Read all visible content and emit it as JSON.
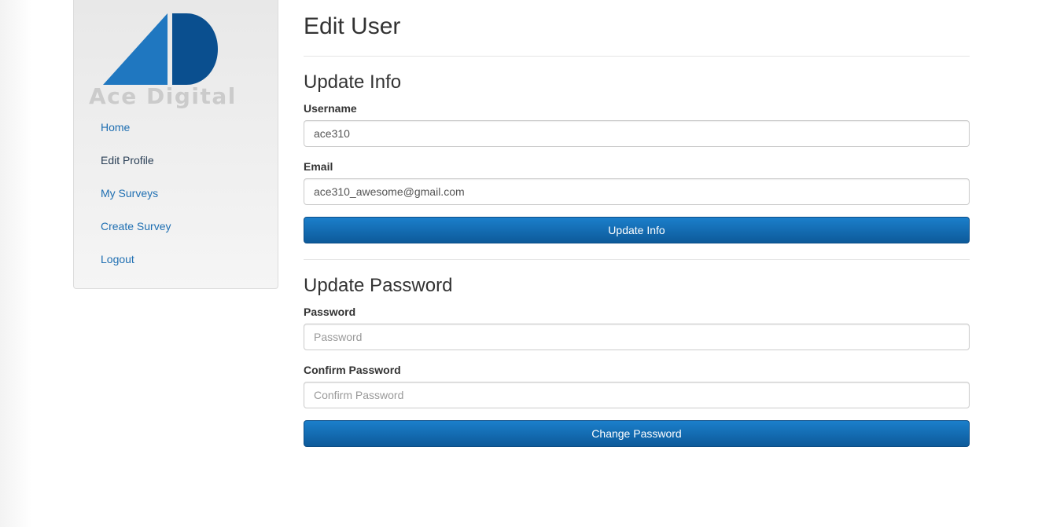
{
  "sidebar": {
    "logo_text": "Ace Digital",
    "items": [
      {
        "label": "Home"
      },
      {
        "label": "Edit Profile",
        "active": true
      },
      {
        "label": "My Surveys"
      },
      {
        "label": "Create Survey"
      },
      {
        "label": "Logout"
      }
    ]
  },
  "main": {
    "title": "Edit User",
    "update_info": {
      "heading": "Update Info",
      "username_label": "Username",
      "username_value": "ace310",
      "email_label": "Email",
      "email_value": "ace310_awesome@gmail.com",
      "button_label": "Update Info"
    },
    "update_password": {
      "heading": "Update Password",
      "password_label": "Password",
      "password_placeholder": "Password",
      "confirm_label": "Confirm Password",
      "confirm_placeholder": "Confirm Password",
      "button_label": "Change Password"
    }
  },
  "colors": {
    "link": "#1f6fb2",
    "active_link": "#2a3f56",
    "button_top": "#1b7fcb",
    "button_bottom": "#0d5a9a",
    "logo_light_blue": "#1f77c0",
    "logo_dark_blue": "#0a4f8f",
    "logo_text": "#cbcbcb"
  }
}
